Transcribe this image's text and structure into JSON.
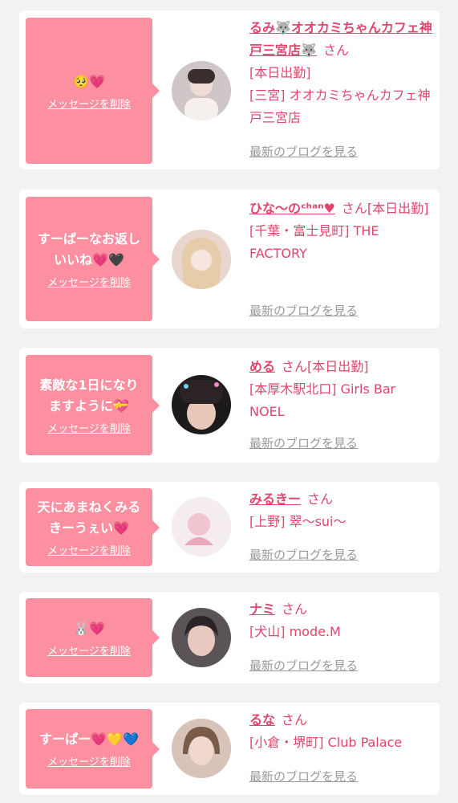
{
  "colors": {
    "bubble": "#fc8fa0",
    "accent": "#e0456c",
    "blog_link": "#999999"
  },
  "cards": [
    {
      "message": "🥺💗",
      "delete_label": "メッセージを削除",
      "name": "るみ🐺オオカミちゃんカフェ神戸三宮店🐺",
      "honorific": "さん",
      "status": "[本日出勤]",
      "shop": "[三宮] オオカミちゃんカフェ神戸三宮店",
      "blog_label": "最新のブログを見る"
    },
    {
      "message": "すーぱーなお返しいいね💗🖤",
      "delete_label": "メッセージを削除",
      "name": "ひな〜のᶜʰᵃⁿ♥",
      "honorific": "さん",
      "status": "[本日出勤]",
      "shop": "[千葉・富士見町] THE FACTORY",
      "blog_label": "最新のブログを見る"
    },
    {
      "message": "素敵な1日になりますように💝",
      "delete_label": "メッセージを削除",
      "name": "める",
      "honorific": "さん",
      "status": "[本日出勤]",
      "shop": "[本厚木駅北口] Girls Bar NOEL",
      "blog_label": "最新のブログを見る"
    },
    {
      "message": "天にあまねくみるきーうぇい💗",
      "delete_label": "メッセージを削除",
      "name": "みるきー",
      "honorific": "さん",
      "status": "",
      "shop": "[上野] 翠〜sui〜",
      "blog_label": "最新のブログを見る"
    },
    {
      "message": "🐰💗",
      "delete_label": "メッセージを削除",
      "name": "ナミ",
      "honorific": "さん",
      "status": "",
      "shop": "[犬山] mode.M",
      "blog_label": "最新のブログを見る"
    },
    {
      "message": "すーぱー💗💛💙",
      "delete_label": "メッセージを削除",
      "name": "るな",
      "honorific": "さん",
      "status": "",
      "shop": "[小倉・堺町] Club Palace",
      "blog_label": "最新のブログを見る"
    }
  ]
}
